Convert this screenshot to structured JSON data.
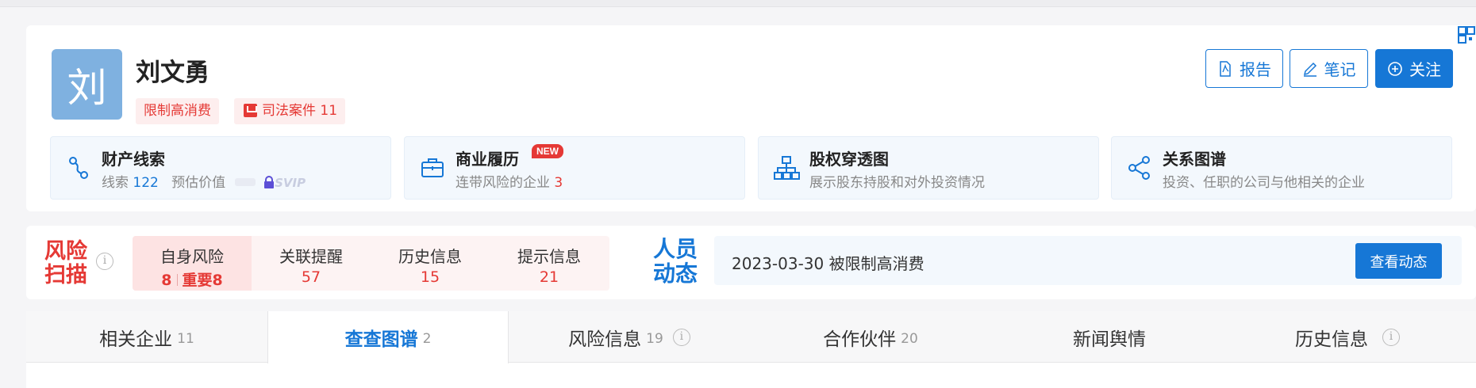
{
  "profile": {
    "avatar_char": "刘",
    "name": "刘文勇",
    "tags": {
      "limit": "限制高消费",
      "judicial": "司法案件 11"
    },
    "buttons": {
      "report": "报告",
      "note": "笔记",
      "follow": "关注"
    },
    "features": [
      {
        "title": "财产线索",
        "sub_prefix": "线索",
        "sub_count": "122",
        "sub_mid": "预估价值",
        "sub_badge": "SVIP",
        "icon": "link-icon"
      },
      {
        "title": "商业履历",
        "badge": "NEW",
        "sub_prefix": "连带风险的企业",
        "sub_count": "3",
        "icon": "briefcase-icon"
      },
      {
        "title": "股权穿透图",
        "sub": "展示股东持股和对外投资情况",
        "icon": "org-chart-icon"
      },
      {
        "title": "关系图谱",
        "sub": "投资、任职的公司与他相关的企业",
        "icon": "share-icon"
      }
    ]
  },
  "risk": {
    "title": "风险扫描",
    "cells": [
      {
        "label": "自身风险",
        "value": "8",
        "value_extra": "重要8"
      },
      {
        "label": "关联提醒",
        "value": "57"
      },
      {
        "label": "历史信息",
        "value": "15"
      },
      {
        "label": "提示信息",
        "value": "21"
      }
    ],
    "dynamic_title": "人员动态",
    "dynamic_text": "2023-03-30 被限制高消费",
    "dynamic_button": "查看动态"
  },
  "tabs": [
    {
      "label": "相关企业",
      "count": "11"
    },
    {
      "label": "查查图谱",
      "count": "2"
    },
    {
      "label": "风险信息",
      "count": "19"
    },
    {
      "label": "合作伙伴",
      "count": "20"
    },
    {
      "label": "新闻舆情",
      "count": ""
    },
    {
      "label": "历史信息",
      "count": ""
    }
  ],
  "colors": {
    "accent": "#1677d6",
    "danger": "#e53935",
    "avatar": "#7fb1e0"
  }
}
